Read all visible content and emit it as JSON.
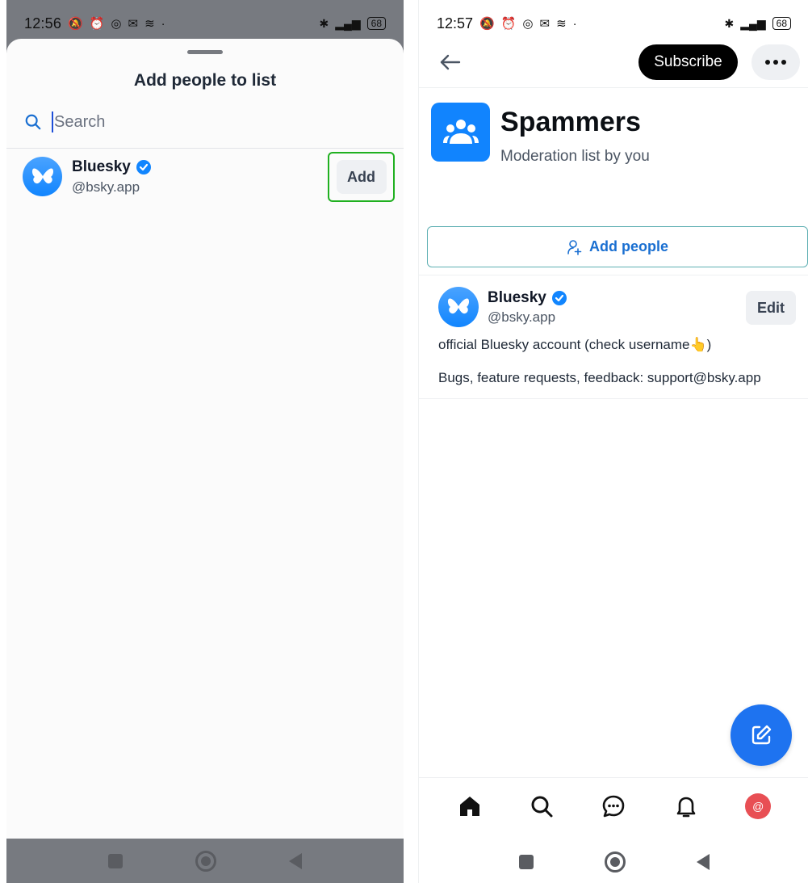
{
  "left": {
    "status": {
      "time": "12:56",
      "battery": "68"
    },
    "sheet": {
      "title": "Add people to list",
      "search_placeholder": "Search",
      "results": [
        {
          "name": "Bluesky",
          "handle": "@bsky.app",
          "action_label": "Add"
        }
      ]
    }
  },
  "right": {
    "status": {
      "time": "12:57",
      "battery": "68"
    },
    "header": {
      "subscribe_label": "Subscribe"
    },
    "list": {
      "title": "Spammers",
      "subtitle": "Moderation list by you",
      "add_people_label": "Add people"
    },
    "members": [
      {
        "name": "Bluesky",
        "handle": "@bsky.app",
        "action_label": "Edit",
        "description_line1": "official Bluesky account (check username👆)",
        "description_line2": "Bugs, feature requests, feedback: support@bsky.app"
      }
    ],
    "tabbar": {
      "avatar_glyph": "@"
    }
  },
  "colors": {
    "brand_blue": "#1185fe",
    "highlight_green": "#20b020",
    "subscribe_bg": "#000000",
    "avatar_red": "#e84f54"
  }
}
